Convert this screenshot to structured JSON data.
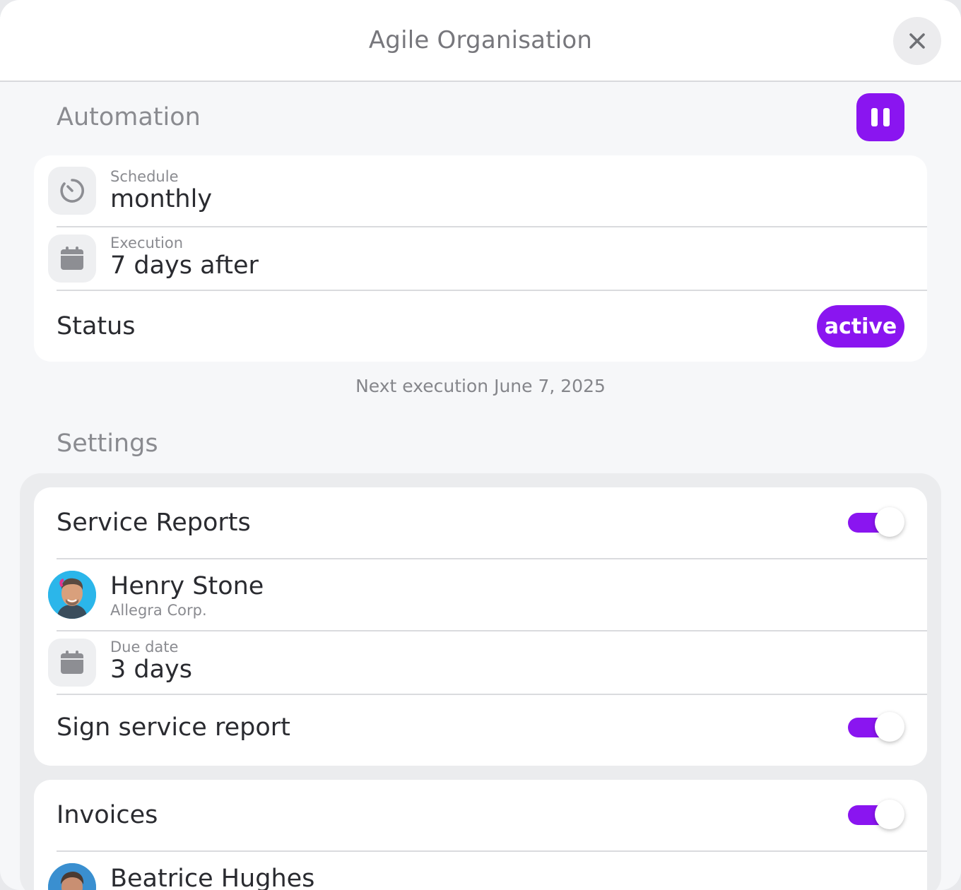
{
  "header": {
    "title": "Agile Organisation"
  },
  "automation": {
    "title": "Automation",
    "schedule": {
      "label": "Schedule",
      "value": "monthly"
    },
    "execution": {
      "label": "Execution",
      "value": "7 days after"
    },
    "status": {
      "label": "Status",
      "value": "active"
    },
    "next_execution": "Next execution June 7, 2025"
  },
  "settings": {
    "title": "Settings",
    "service_reports": {
      "label": "Service Reports",
      "enabled": true,
      "contact": {
        "name": "Henry Stone",
        "company": "Allegra Corp."
      },
      "due_date": {
        "label": "Due date",
        "value": "3 days"
      },
      "sign": {
        "label": "Sign service report",
        "enabled": true
      }
    },
    "invoices": {
      "label": "Invoices",
      "enabled": true,
      "contact": {
        "name": "Beatrice Hughes"
      }
    }
  },
  "colors": {
    "accent": "#8a15f0",
    "background": "#f6f7f9"
  },
  "icons": [
    "close-icon",
    "pause-icon",
    "timer-icon",
    "calendar-icon"
  ]
}
